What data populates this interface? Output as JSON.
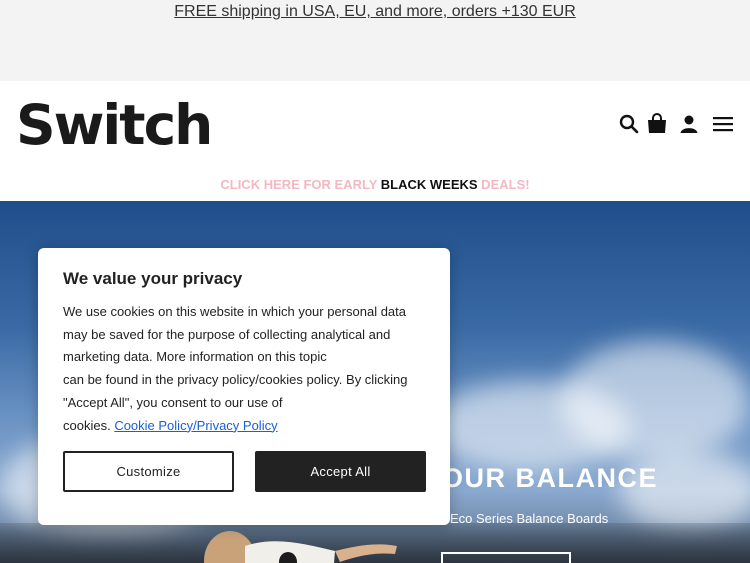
{
  "topbar": {
    "shipping_text": "FREE shipping in USA, EU, and more, orders +130 EUR"
  },
  "header": {
    "logo_text": "Switch",
    "icons": [
      "search-icon",
      "shopping-bag-icon",
      "account-icon",
      "menu-icon"
    ]
  },
  "promo": {
    "part1": "CLICK HERE FOR EARLY ",
    "part2": "BLACK WEEKS",
    "part3": " DEALS!",
    "colors": {
      "pink": "#f4b8c2",
      "dark": "#111111"
    }
  },
  "hero": {
    "title": "OUR BALANCE",
    "subtitle": "Eco Series Balance Boards"
  },
  "cookie_banner": {
    "title": "We value your privacy",
    "body_lines": [
      "We use cookies on this website in which your personal data",
      "may be saved for the purpose of collecting analytical and",
      "marketing data. More information on this topic",
      "can be found in the privacy policy/cookies policy. By clicking",
      "\"Accept All\", you consent to our use of"
    ],
    "body_last": "cookies. ",
    "link_text": "Cookie Policy/Privacy Policy",
    "customize_label": "Customize",
    "accept_label": "Accept All",
    "colors": {
      "link": "#1a5fd6",
      "button_dark": "#222222"
    }
  }
}
